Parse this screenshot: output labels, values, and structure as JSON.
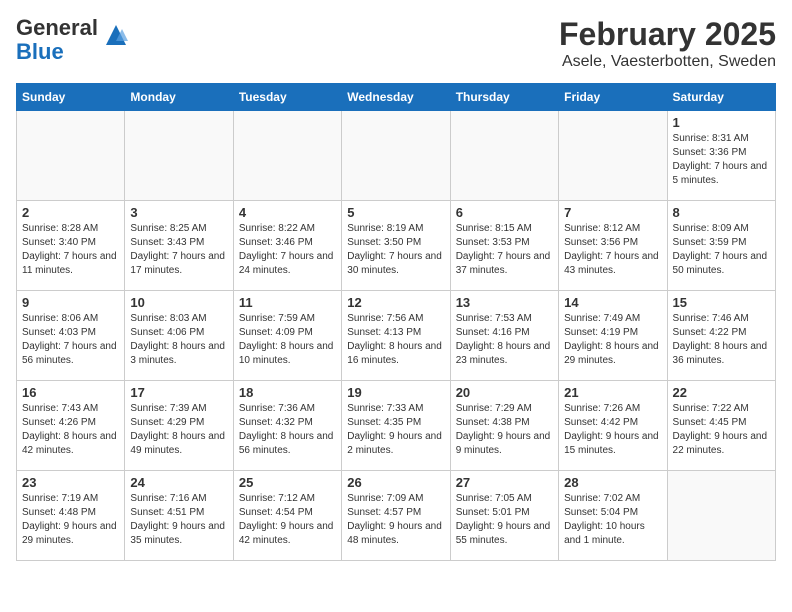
{
  "header": {
    "logo_general": "General",
    "logo_blue": "Blue",
    "month": "February 2025",
    "location": "Asele, Vaesterbotten, Sweden"
  },
  "weekdays": [
    "Sunday",
    "Monday",
    "Tuesday",
    "Wednesday",
    "Thursday",
    "Friday",
    "Saturday"
  ],
  "weeks": [
    [
      {
        "day": "",
        "info": ""
      },
      {
        "day": "",
        "info": ""
      },
      {
        "day": "",
        "info": ""
      },
      {
        "day": "",
        "info": ""
      },
      {
        "day": "",
        "info": ""
      },
      {
        "day": "",
        "info": ""
      },
      {
        "day": "1",
        "info": "Sunrise: 8:31 AM\nSunset: 3:36 PM\nDaylight: 7 hours and 5 minutes."
      }
    ],
    [
      {
        "day": "2",
        "info": "Sunrise: 8:28 AM\nSunset: 3:40 PM\nDaylight: 7 hours and 11 minutes."
      },
      {
        "day": "3",
        "info": "Sunrise: 8:25 AM\nSunset: 3:43 PM\nDaylight: 7 hours and 17 minutes."
      },
      {
        "day": "4",
        "info": "Sunrise: 8:22 AM\nSunset: 3:46 PM\nDaylight: 7 hours and 24 minutes."
      },
      {
        "day": "5",
        "info": "Sunrise: 8:19 AM\nSunset: 3:50 PM\nDaylight: 7 hours and 30 minutes."
      },
      {
        "day": "6",
        "info": "Sunrise: 8:15 AM\nSunset: 3:53 PM\nDaylight: 7 hours and 37 minutes."
      },
      {
        "day": "7",
        "info": "Sunrise: 8:12 AM\nSunset: 3:56 PM\nDaylight: 7 hours and 43 minutes."
      },
      {
        "day": "8",
        "info": "Sunrise: 8:09 AM\nSunset: 3:59 PM\nDaylight: 7 hours and 50 minutes."
      }
    ],
    [
      {
        "day": "9",
        "info": "Sunrise: 8:06 AM\nSunset: 4:03 PM\nDaylight: 7 hours and 56 minutes."
      },
      {
        "day": "10",
        "info": "Sunrise: 8:03 AM\nSunset: 4:06 PM\nDaylight: 8 hours and 3 minutes."
      },
      {
        "day": "11",
        "info": "Sunrise: 7:59 AM\nSunset: 4:09 PM\nDaylight: 8 hours and 10 minutes."
      },
      {
        "day": "12",
        "info": "Sunrise: 7:56 AM\nSunset: 4:13 PM\nDaylight: 8 hours and 16 minutes."
      },
      {
        "day": "13",
        "info": "Sunrise: 7:53 AM\nSunset: 4:16 PM\nDaylight: 8 hours and 23 minutes."
      },
      {
        "day": "14",
        "info": "Sunrise: 7:49 AM\nSunset: 4:19 PM\nDaylight: 8 hours and 29 minutes."
      },
      {
        "day": "15",
        "info": "Sunrise: 7:46 AM\nSunset: 4:22 PM\nDaylight: 8 hours and 36 minutes."
      }
    ],
    [
      {
        "day": "16",
        "info": "Sunrise: 7:43 AM\nSunset: 4:26 PM\nDaylight: 8 hours and 42 minutes."
      },
      {
        "day": "17",
        "info": "Sunrise: 7:39 AM\nSunset: 4:29 PM\nDaylight: 8 hours and 49 minutes."
      },
      {
        "day": "18",
        "info": "Sunrise: 7:36 AM\nSunset: 4:32 PM\nDaylight: 8 hours and 56 minutes."
      },
      {
        "day": "19",
        "info": "Sunrise: 7:33 AM\nSunset: 4:35 PM\nDaylight: 9 hours and 2 minutes."
      },
      {
        "day": "20",
        "info": "Sunrise: 7:29 AM\nSunset: 4:38 PM\nDaylight: 9 hours and 9 minutes."
      },
      {
        "day": "21",
        "info": "Sunrise: 7:26 AM\nSunset: 4:42 PM\nDaylight: 9 hours and 15 minutes."
      },
      {
        "day": "22",
        "info": "Sunrise: 7:22 AM\nSunset: 4:45 PM\nDaylight: 9 hours and 22 minutes."
      }
    ],
    [
      {
        "day": "23",
        "info": "Sunrise: 7:19 AM\nSunset: 4:48 PM\nDaylight: 9 hours and 29 minutes."
      },
      {
        "day": "24",
        "info": "Sunrise: 7:16 AM\nSunset: 4:51 PM\nDaylight: 9 hours and 35 minutes."
      },
      {
        "day": "25",
        "info": "Sunrise: 7:12 AM\nSunset: 4:54 PM\nDaylight: 9 hours and 42 minutes."
      },
      {
        "day": "26",
        "info": "Sunrise: 7:09 AM\nSunset: 4:57 PM\nDaylight: 9 hours and 48 minutes."
      },
      {
        "day": "27",
        "info": "Sunrise: 7:05 AM\nSunset: 5:01 PM\nDaylight: 9 hours and 55 minutes."
      },
      {
        "day": "28",
        "info": "Sunrise: 7:02 AM\nSunset: 5:04 PM\nDaylight: 10 hours and 1 minute."
      },
      {
        "day": "",
        "info": ""
      }
    ]
  ]
}
